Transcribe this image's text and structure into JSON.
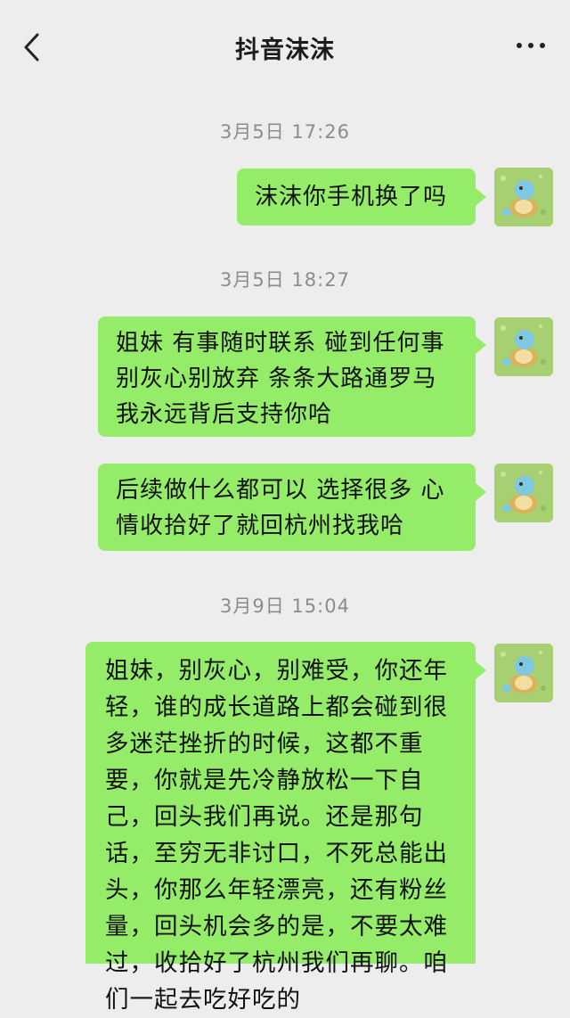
{
  "header": {
    "back_icon": "chevron-left-icon",
    "title": "抖音沫沫",
    "more_icon": "more-dots-icon"
  },
  "timestamps": [
    "3月5日 17:26",
    "3月5日 18:27",
    "3月9日 15:04"
  ],
  "messages": [
    {
      "sender": "self",
      "text": "沫沫你手机换了吗"
    },
    {
      "sender": "self",
      "text": "姐妹 有事随时联系 碰到任何事别灰心别放弃 条条大路通罗马我永远背后支持你哈"
    },
    {
      "sender": "self",
      "text": "后续做什么都可以 选择很多 心情收拾好了就回杭州找我哈"
    },
    {
      "sender": "self",
      "text": "姐妹，别灰心，别难受，你还年轻，谁的成长道路上都会碰到很多迷茫挫折的时候，这都不重要，你就是先冷静放松一下自己，回头我们再说。还是那句话，至穷无非讨口，不死总能出头，你那么年轻漂亮，还有粉丝量，回头机会多的是，不要太难过，收拾好了杭州我们再聊。咱们一起去吃好吃的"
    }
  ],
  "avatar_icon": "squirtle-avatar-icon",
  "colors": {
    "background": "#ededed",
    "bubble": "#95ec69",
    "timestamp": "#8c8c8c"
  }
}
